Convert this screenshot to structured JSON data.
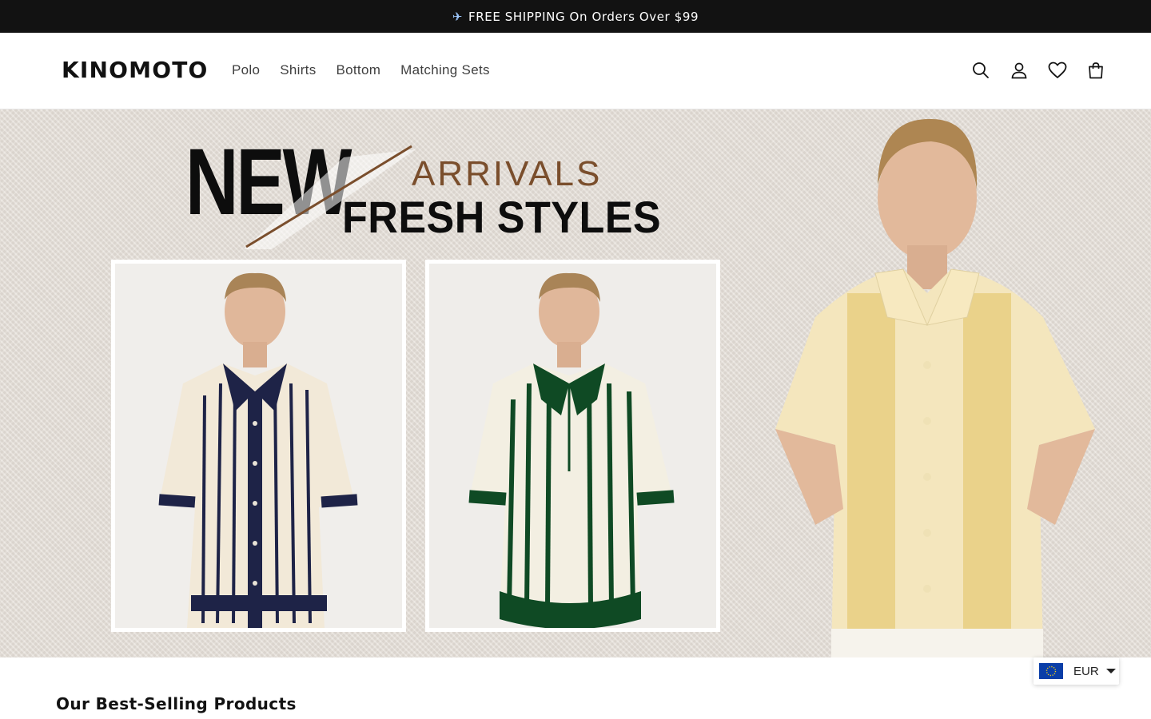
{
  "announcement": {
    "icon": "airplane-icon",
    "text": "FREE SHIPPING On Orders Over $99"
  },
  "header": {
    "logo": "KINOMOTO",
    "nav": [
      {
        "label": "Polo"
      },
      {
        "label": "Shirts"
      },
      {
        "label": "Bottom"
      },
      {
        "label": "Matching Sets"
      }
    ],
    "icons": [
      "search-icon",
      "account-icon",
      "wishlist-heart-icon",
      "cart-bag-icon"
    ]
  },
  "hero": {
    "headline_new": "NEW",
    "headline_arrivals": "ARRIVALS",
    "headline_fresh": "FRESH STYLES",
    "accent_color": "#7a4e2c",
    "products": [
      {
        "description_icon": "navy-stripe-knit-shirt-image"
      },
      {
        "description_icon": "green-stripe-knit-polo-image"
      }
    ],
    "feature_image": "yellow-stripe-knit-shirt-model-image"
  },
  "section": {
    "title": "Our Best-Selling Products"
  },
  "currency": {
    "flag_icon": "eu-flag-icon",
    "code": "EUR"
  }
}
